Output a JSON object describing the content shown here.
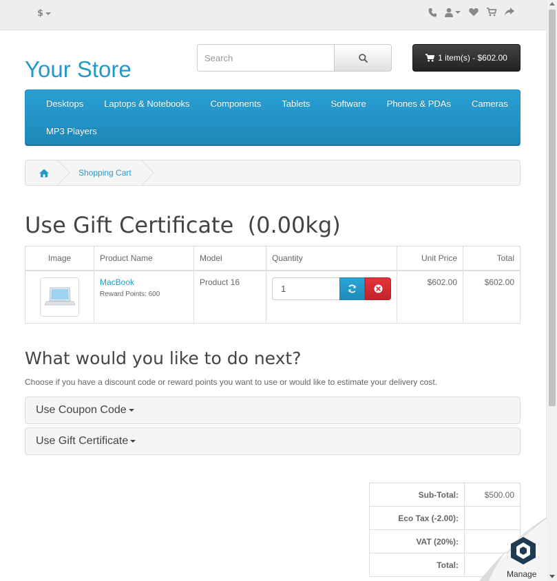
{
  "topbar": {
    "currency": "$",
    "icons": [
      "phone-icon",
      "user-icon",
      "heart-icon",
      "cart-icon",
      "share-icon"
    ]
  },
  "header": {
    "logo": "Your Store",
    "search_placeholder": "Search",
    "cart_button": "1 item(s) - $602.00"
  },
  "menu": {
    "row1": [
      "Desktops",
      "Laptops & Notebooks",
      "Components",
      "Tablets",
      "Software",
      "Phones & PDAs",
      "Cameras"
    ],
    "row2": [
      "MP3 Players"
    ]
  },
  "breadcrumb": {
    "home_icon": "home-icon",
    "current": "Shopping Cart"
  },
  "page_title": "Use Gift Certificate  (0.00kg)",
  "cart_table": {
    "headers": {
      "image": "Image",
      "name": "Product Name",
      "model": "Model",
      "quantity": "Quantity",
      "unit_price": "Unit Price",
      "total": "Total"
    },
    "rows": [
      {
        "name": "MacBook",
        "reward": "Reward Points: 600",
        "model": "Product 16",
        "quantity": "1",
        "unit_price": "$602.00",
        "total": "$602.00"
      }
    ]
  },
  "next": {
    "title": "What would you like to do next?",
    "description": "Choose if you have a discount code or reward points you want to use or would like to estimate your delivery cost.",
    "panels": [
      "Use Coupon Code",
      "Use Gift Certificate"
    ]
  },
  "totals": {
    "rows": [
      {
        "label": "Sub-Total:",
        "value": "$500.00"
      },
      {
        "label": "Eco Tax (-2.00):",
        "value": ""
      },
      {
        "label": "VAT (20%):",
        "value": ""
      },
      {
        "label": "Total:",
        "value": ""
      }
    ]
  },
  "overlay": {
    "manage_label": "Manage"
  },
  "colors": {
    "accent": "#229ac8",
    "menu": "#229ac8",
    "remove": "#da2f37"
  }
}
